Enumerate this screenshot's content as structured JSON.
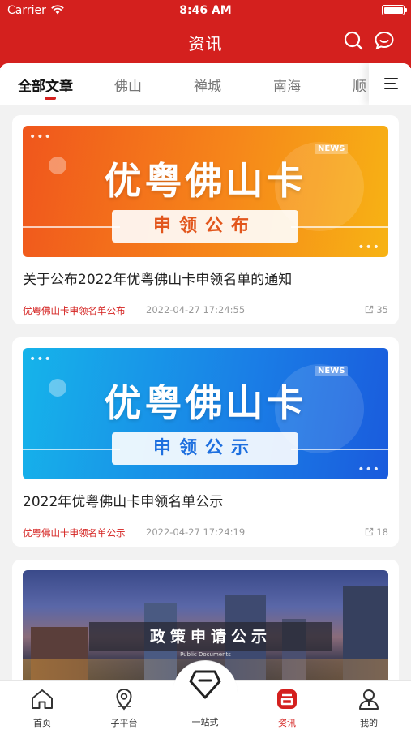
{
  "status_bar": {
    "carrier": "Carrier",
    "time": "8:46 AM"
  },
  "header": {
    "title": "资讯"
  },
  "tabs": [
    {
      "label": "全部文章",
      "active": true
    },
    {
      "label": "佛山",
      "active": false
    },
    {
      "label": "禅城",
      "active": false
    },
    {
      "label": "南海",
      "active": false
    },
    {
      "label": "顺",
      "active": false
    }
  ],
  "articles": [
    {
      "banner": {
        "title": "优粤佛山卡",
        "badge": "NEWS",
        "subtitle": "申领公布",
        "theme": "orange"
      },
      "title": "关于公布2022年优粤佛山卡申领名单的通知",
      "tag": "优粤佛山卡申领名单公布",
      "date": "2022-04-27 17:24:55",
      "shares": "35"
    },
    {
      "banner": {
        "title": "优粤佛山卡",
        "badge": "NEWS",
        "subtitle": "申领公示",
        "theme": "blue"
      },
      "title": "2022年优粤佛山卡申领名单公示",
      "tag": "优粤佛山卡申领名单公示",
      "date": "2022-04-27 17:24:19",
      "shares": "18"
    },
    {
      "banner": {
        "title": "政策申请公示",
        "subtitle": "Public Documents"
      }
    }
  ],
  "bottom_nav": [
    {
      "label": "首页",
      "icon": "home-icon"
    },
    {
      "label": "子平台",
      "icon": "location-pin-icon"
    },
    {
      "label": "一站式",
      "icon": "one-stop-icon"
    },
    {
      "label": "资讯",
      "icon": "news-icon",
      "active": true
    },
    {
      "label": "我的",
      "icon": "profile-icon"
    }
  ],
  "colors": {
    "brand_red": "#d4201e",
    "orange_banner": "#f6861a",
    "blue_banner": "#1a7ee6"
  }
}
